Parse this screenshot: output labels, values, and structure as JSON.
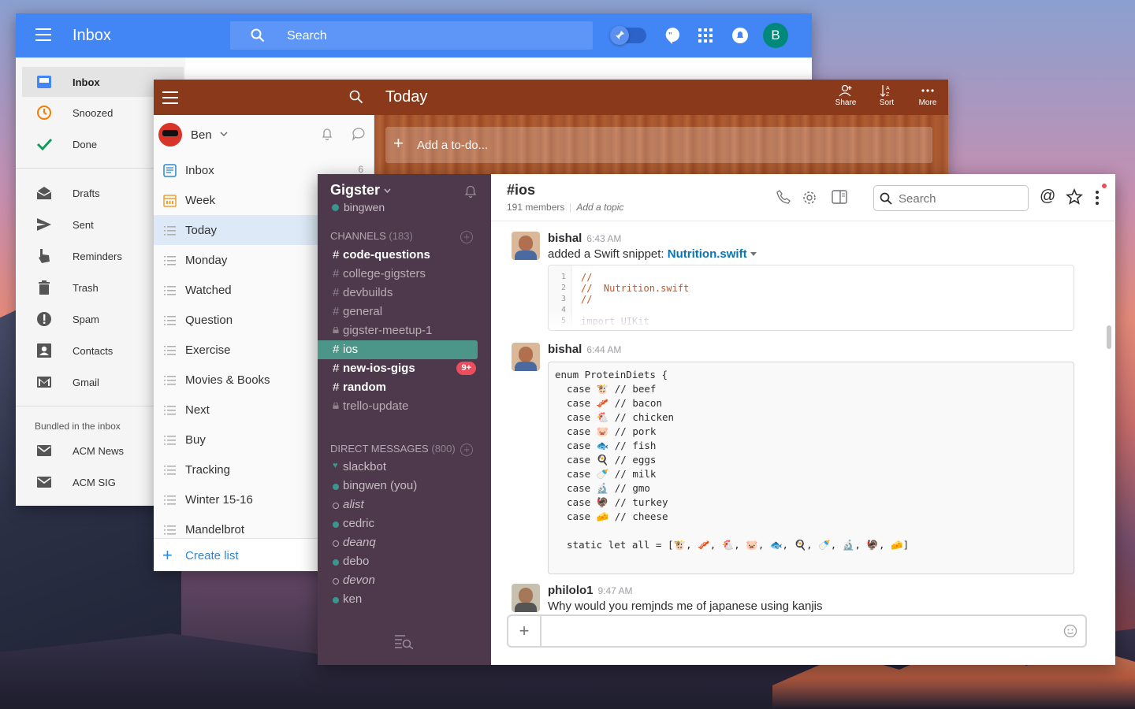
{
  "gmail": {
    "title": "Inbox",
    "search_placeholder": "Search",
    "avatar_letter": "B",
    "nav": [
      {
        "label": "Inbox",
        "icon": "inbox-icon",
        "active": true
      },
      {
        "label": "Snoozed",
        "icon": "clock-icon"
      },
      {
        "label": "Done",
        "icon": "checkmark-icon"
      },
      {
        "label": "Drafts",
        "icon": "drafts-icon"
      },
      {
        "label": "Sent",
        "icon": "send-icon"
      },
      {
        "label": "Reminders",
        "icon": "reminder-hand-icon"
      },
      {
        "label": "Trash",
        "icon": "trash-icon"
      },
      {
        "label": "Spam",
        "icon": "spam-icon"
      },
      {
        "label": "Contacts",
        "icon": "contacts-icon"
      },
      {
        "label": "Gmail",
        "icon": "gmail-icon"
      }
    ],
    "bundled_heading": "Bundled in the inbox",
    "bundles": [
      {
        "label": "ACM News",
        "icon": "mail-bundle-icon"
      },
      {
        "label": "ACM SIG",
        "icon": "mail-bundle-icon"
      }
    ],
    "colors": {
      "bar": "#4285f4",
      "avatar": "#00897b",
      "snoozed": "#f57c00",
      "done": "#0f9d58"
    }
  },
  "wunderlist": {
    "user": "Ben",
    "lists": [
      {
        "label": "Inbox",
        "icon": "inbox-tray-icon"
      },
      {
        "label": "Week",
        "icon": "calendar-week-icon"
      },
      {
        "label": "Today",
        "icon": "list-icon",
        "active": true
      },
      {
        "label": "Monday",
        "icon": "list-icon"
      },
      {
        "label": "Watched",
        "icon": "list-icon"
      },
      {
        "label": "Question",
        "icon": "list-icon"
      },
      {
        "label": "Exercise",
        "icon": "list-icon"
      },
      {
        "label": "Movies & Books",
        "icon": "list-icon"
      },
      {
        "label": "Next",
        "icon": "list-icon"
      },
      {
        "label": "Buy",
        "icon": "list-icon"
      },
      {
        "label": "Tracking",
        "icon": "list-icon"
      },
      {
        "label": "Winter 15-16",
        "icon": "list-icon"
      },
      {
        "label": "Mandelbrot",
        "icon": "list-icon"
      }
    ],
    "inbox_count": "6",
    "create_list": "Create list",
    "main_title": "Today",
    "actions": [
      {
        "label": "Share",
        "icon": "share-person-icon"
      },
      {
        "label": "Sort",
        "icon": "sort-az-icon"
      },
      {
        "label": "More",
        "icon": "more-dots-icon"
      }
    ],
    "add_placeholder": "Add a to-do...",
    "colors": {
      "bar": "#8a3a1a",
      "link": "#2b88d9"
    }
  },
  "slack": {
    "team": "Gigster",
    "user": "bingwen",
    "channels_label": "CHANNELS",
    "channels_count": "(183)",
    "channels": [
      {
        "name": "code-questions",
        "bold": true
      },
      {
        "name": "college-gigsters"
      },
      {
        "name": "devbuilds"
      },
      {
        "name": "general"
      },
      {
        "name": "gigster-meetup-1",
        "private": true
      },
      {
        "name": "ios",
        "active": true
      },
      {
        "name": "new-ios-gigs",
        "bold": true,
        "badge": "9+"
      },
      {
        "name": "random",
        "bold": true
      },
      {
        "name": "trello-update",
        "private": true
      }
    ],
    "dm_label": "DIRECT MESSAGES",
    "dm_count": "(800)",
    "dms": [
      {
        "name": "slackbot",
        "status": "heart"
      },
      {
        "name": "bingwen (you)",
        "status": "on"
      },
      {
        "name": "alist",
        "status": "off"
      },
      {
        "name": "cedric",
        "status": "on"
      },
      {
        "name": "deanq",
        "status": "off"
      },
      {
        "name": "debo",
        "status": "on"
      },
      {
        "name": "devon",
        "status": "off"
      },
      {
        "name": "ken",
        "status": "on"
      }
    ],
    "channel": "#ios",
    "members": "191 members",
    "add_topic": "Add a topic",
    "search_placeholder": "Search",
    "at_label": "@",
    "messages": [
      {
        "author": "bishal",
        "time": "6:43 AM",
        "text_prefix": "added a Swift snippet: ",
        "link": "Nutrition.swift",
        "snippet_lines": [
          "//",
          "//  Nutrition.swift",
          "//",
          "",
          "import UIKit"
        ],
        "snippet_nums": [
          "1",
          "2",
          "3",
          "4",
          "5"
        ]
      },
      {
        "author": "bishal",
        "time": "6:44 AM",
        "code": [
          "enum ProteinDiets {",
          "  case 🐮 // beef",
          "  case 🥓 // bacon",
          "  case 🐔 // chicken",
          "  case 🐷 // pork",
          "  case 🐟 // fish",
          "  case 🍳 // eggs",
          "  case 🍼 // milk",
          "  case 🔬 // gmo",
          "  case 🦃 // turkey",
          "  case 🧀 // cheese",
          "",
          "  static let all = [🐮, 🥓, 🐔, 🐷, 🐟, 🍳, 🍼, 🔬, 🦃, 🧀]"
        ]
      },
      {
        "author": "philolo1",
        "time": "9:47 AM",
        "text": "Why would you remjnds me of japanese using kanjis"
      }
    ],
    "colors": {
      "sidebar": "#4d394b",
      "active": "#4c9689",
      "badge": "#eb4d5c",
      "link": "#0576b9"
    }
  }
}
